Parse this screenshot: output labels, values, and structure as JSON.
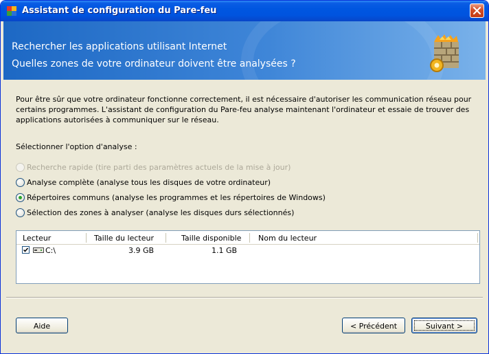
{
  "window": {
    "title": "Assistant de configuration du Pare-feu"
  },
  "header": {
    "line1": "Rechercher les applications utilisant Internet",
    "line2": "Quelles zones de votre ordinateur doivent être analysées ?"
  },
  "intro_text": "Pour être sûr que votre ordinateur fonctionne correctement, il est nécessaire d'autoriser les communication réseau pour certains programmes. L'assistant de configuration du Pare-feu analyse maintenant l'ordinateur et essaie de trouver des applications autorisées à communiquer sur le réseau.",
  "scan_option_label": "Sélectionner l'option d'analyse :",
  "scan_options": [
    {
      "label": "Recherche rapide (tire parti des paramètres actuels de la mise à jour)",
      "selected": false,
      "enabled": false
    },
    {
      "label": "Analyse complète (analyse tous les disques de votre ordinateur)",
      "selected": false,
      "enabled": true
    },
    {
      "label": "Répertoires communs (analyse les programmes et les répertoires de Windows)",
      "selected": true,
      "enabled": true
    },
    {
      "label": "Sélection des zones à analyser (analyse les disques durs sélectionnés)",
      "selected": false,
      "enabled": true
    }
  ],
  "drive_list": {
    "columns": [
      "Lecteur",
      "Taille du lecteur",
      "Taille disponible",
      "Nom du lecteur"
    ],
    "rows": [
      {
        "checked": true,
        "drive": "C:\\",
        "size": "3.9 GB",
        "available": "1.1 GB",
        "name": ""
      }
    ]
  },
  "buttons": {
    "help": "Aide",
    "previous": "< Précédent",
    "next": "Suivant >"
  },
  "colors": {
    "titlebar": "#0054df",
    "header_gradient_start": "#1d68c4",
    "selected_radio": "#2ba42b",
    "dialog_bg": "#ece9d8"
  }
}
